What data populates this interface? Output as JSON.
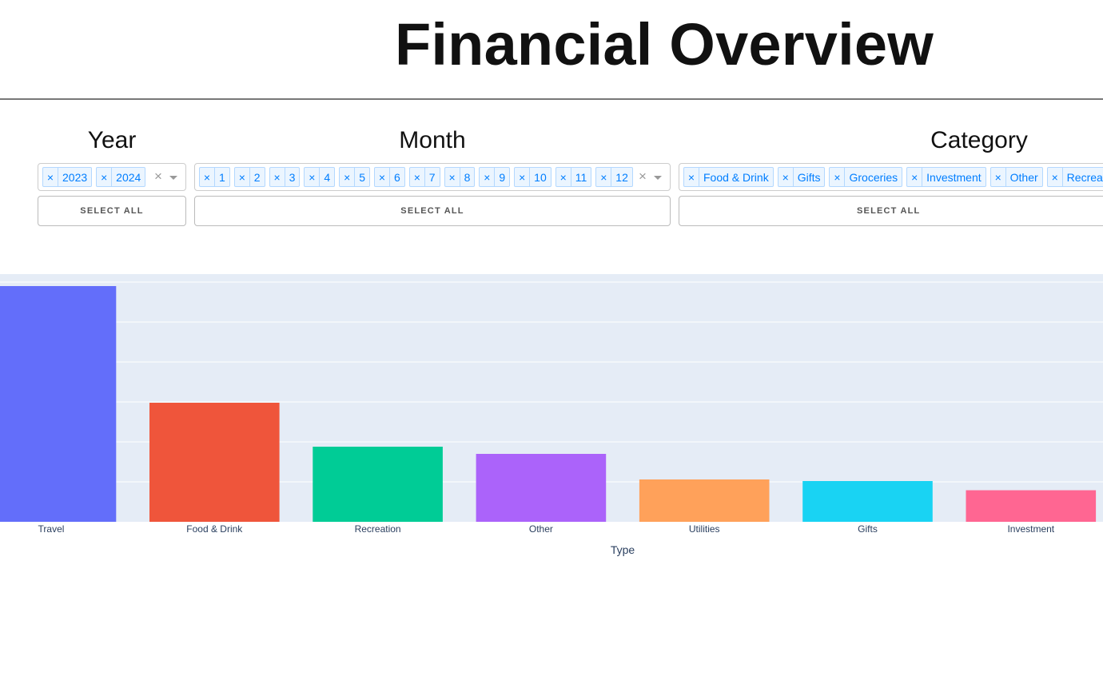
{
  "page": {
    "title": "Financial Overview"
  },
  "filters": {
    "year": {
      "heading": "Year",
      "selected": [
        "2023",
        "2024"
      ],
      "remove_glyph": "×",
      "clear_glyph": "×",
      "select_all_label": "SELECT ALL"
    },
    "month": {
      "heading": "Month",
      "selected": [
        "1",
        "2",
        "3",
        "4",
        "5",
        "6",
        "7",
        "8",
        "9",
        "10",
        "11",
        "12"
      ],
      "remove_glyph": "×",
      "clear_glyph": "×",
      "select_all_label": "SELECT ALL"
    },
    "category": {
      "heading": "Category",
      "selected": [
        "Food & Drink",
        "Gifts",
        "Groceries",
        "Investment",
        "Other",
        "Recreation"
      ],
      "remove_glyph": "×",
      "select_all_label": "SELECT ALL"
    }
  },
  "colors": {
    "chip_text": "#007eff",
    "plot_background": "#e5ecf6"
  },
  "chart_data": {
    "type": "bar",
    "xlabel": "Type",
    "ylabel": "",
    "categories": [
      "Travel",
      "Food & Drink",
      "Recreation",
      "Other",
      "Utilities",
      "Gifts",
      "Investment"
    ],
    "values": [
      5.9,
      2.98,
      1.88,
      1.7,
      1.06,
      1.02,
      0.79
    ],
    "ylim": [
      0,
      6
    ],
    "colors": [
      "#636efa",
      "#ef553b",
      "#00cc96",
      "#ab63fa",
      "#ffa15a",
      "#19d3f3",
      "#ff6692"
    ],
    "grid": true,
    "legend": "none"
  }
}
